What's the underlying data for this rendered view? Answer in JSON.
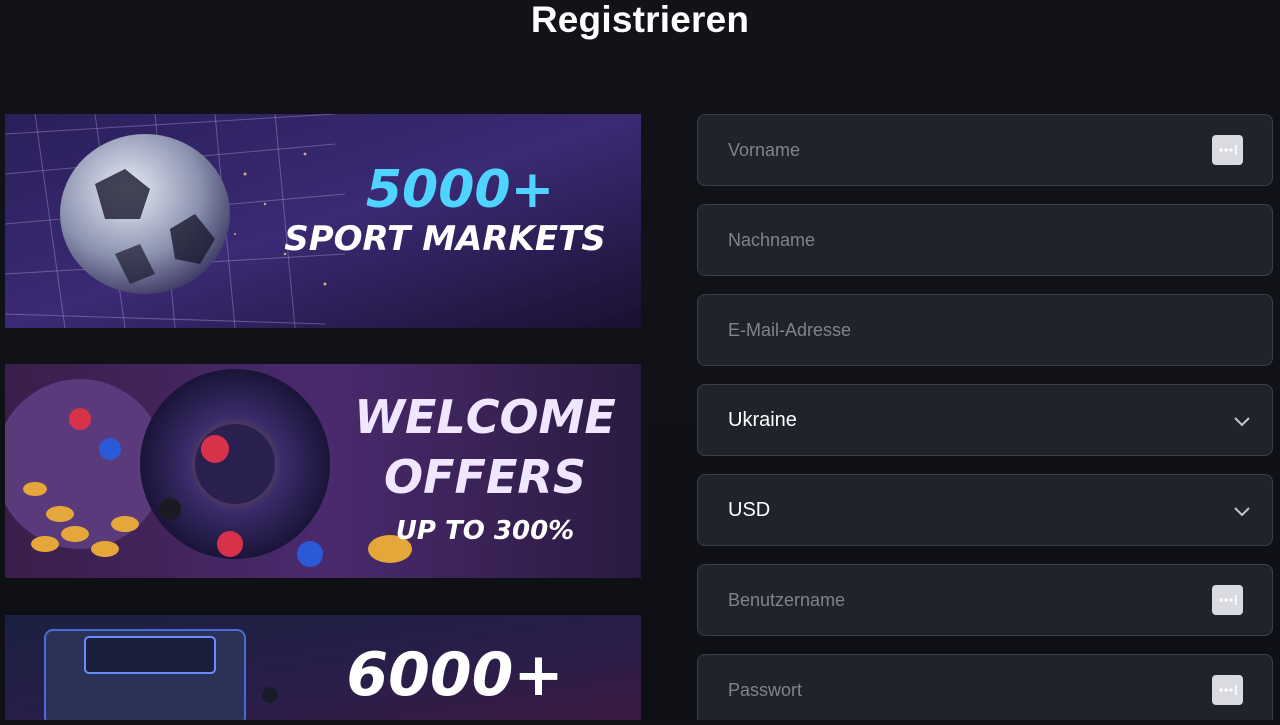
{
  "page": {
    "title": "Registrieren"
  },
  "banners": [
    {
      "line1": "5000+",
      "line2": "SPORT MARKETS"
    },
    {
      "line1": "WELCOME",
      "line2": "OFFERS",
      "line3": "UP TO 300%"
    },
    {
      "line1": "6000+"
    }
  ],
  "form": {
    "first_name": {
      "placeholder": "Vorname",
      "icon": "password-manager-icon"
    },
    "last_name": {
      "placeholder": "Nachname"
    },
    "email": {
      "placeholder": "E-Mail-Adresse"
    },
    "country": {
      "value": "Ukraine",
      "icon": "chevron-down-icon"
    },
    "currency": {
      "value": "USD",
      "icon": "chevron-down-icon"
    },
    "username": {
      "placeholder": "Benutzername",
      "icon": "password-manager-icon"
    },
    "password": {
      "placeholder": "Passwort",
      "icon": "password-manager-icon"
    }
  }
}
